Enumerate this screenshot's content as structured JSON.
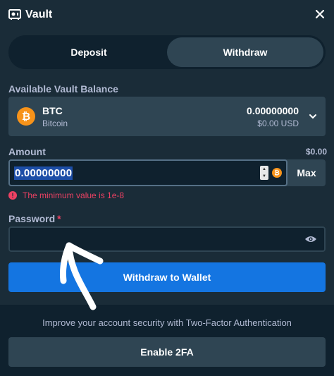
{
  "header": {
    "title": "Vault"
  },
  "tabs": [
    {
      "label": "Deposit",
      "active": false
    },
    {
      "label": "Withdraw",
      "active": true
    }
  ],
  "balance": {
    "label": "Available Vault Balance",
    "coin_code": "BTC",
    "coin_name": "Bitcoin",
    "amount": "0.00000000",
    "usd": "$0.00 USD"
  },
  "amount": {
    "label": "Amount",
    "usd_value": "$0.00",
    "value": "0.00000000",
    "max_label": "Max"
  },
  "error": {
    "message": "The minimum value is 1e-8"
  },
  "password": {
    "label": "Password",
    "required_mark": "*",
    "value": ""
  },
  "actions": {
    "withdraw_label": "Withdraw to Wallet"
  },
  "footer": {
    "security_text": "Improve your account security with Two-Factor Authentication",
    "enable_2fa_label": "Enable 2FA"
  },
  "colors": {
    "background": "#1a2c38",
    "dark": "#0f212e",
    "panel": "#2f4553",
    "accent_blue": "#1475e1",
    "error": "#ed4163",
    "bitcoin": "#f7931a"
  },
  "icons": [
    "vault-icon",
    "close-icon",
    "bitcoin-icon",
    "chevron-down-icon",
    "stepper-icon",
    "error-icon",
    "eye-icon"
  ]
}
